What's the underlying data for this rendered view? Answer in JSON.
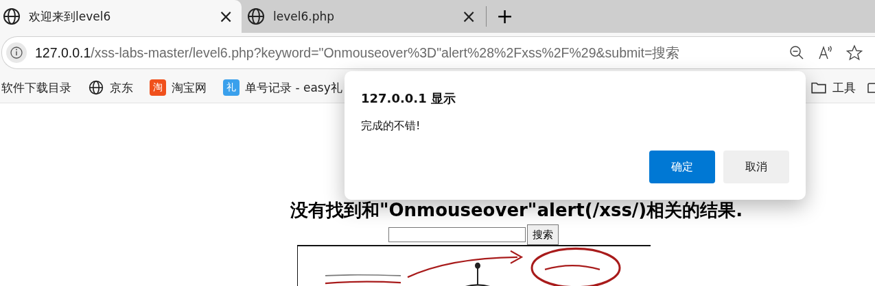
{
  "tabs": [
    {
      "title": "欢迎来到level6",
      "selected": true,
      "close": "×"
    },
    {
      "title": "level6.php",
      "selected": false,
      "close": "×"
    }
  ],
  "new_tab": "+",
  "address": {
    "host": "127.0.0.1",
    "path": "/xss-labs-master/level6.php?keyword=\"Onmouseover%3D\"alert%28%2Fxss%2F%29&submit=搜索"
  },
  "bookmarks": [
    {
      "kind": "text",
      "label": "软件下载目录"
    },
    {
      "kind": "globe",
      "label": "京东"
    },
    {
      "kind": "taobao",
      "label": "淘宝网",
      "icon_text": "淘"
    },
    {
      "kind": "li",
      "label": "单号记录 - easy礼",
      "icon_text": "礼"
    }
  ],
  "bookmark_folders": [
    {
      "label": "工具"
    }
  ],
  "page": {
    "heading": "没有找到和\"Onmouseover\"alert(/xss/)相关的结果.",
    "search_button": "搜索"
  },
  "dialog": {
    "title": "127.0.0.1 显示",
    "message": "完成的不错!",
    "ok": "确定",
    "cancel": "取消"
  }
}
